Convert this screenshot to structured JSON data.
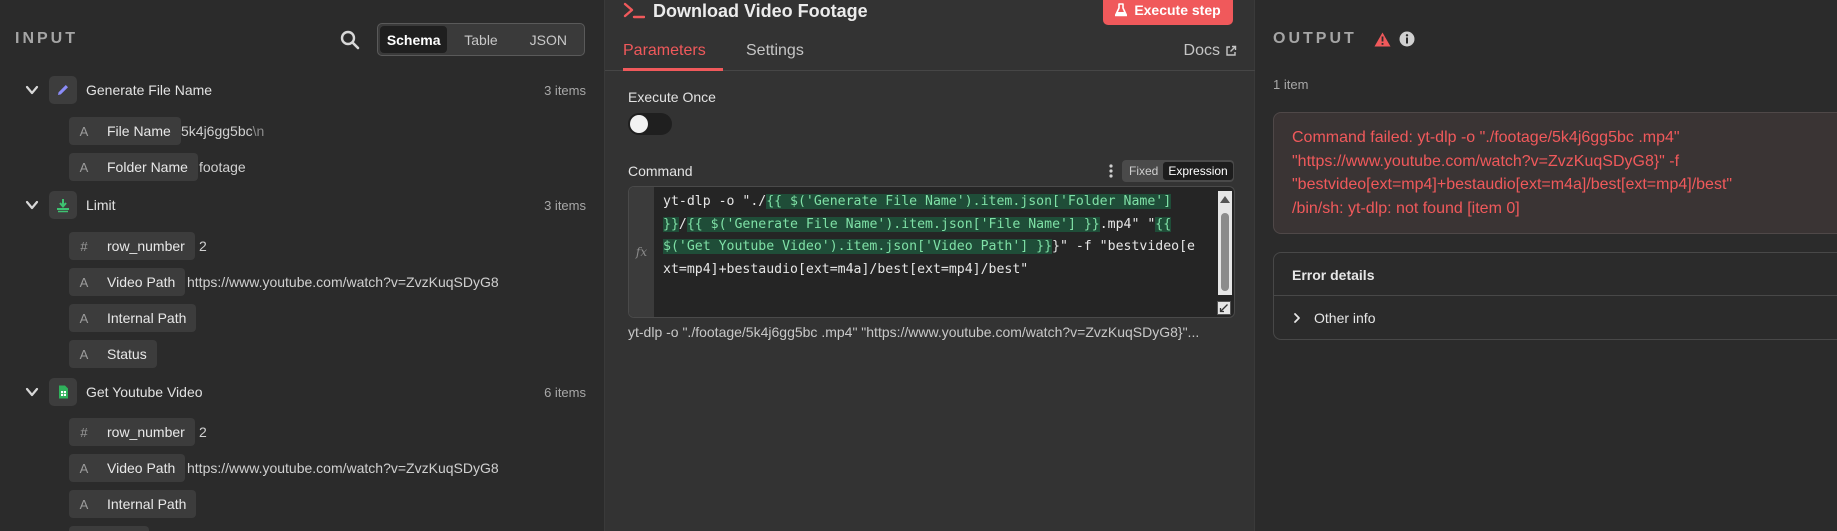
{
  "input": {
    "title": "INPUT",
    "view_options": [
      "Schema",
      "Table",
      "JSON"
    ],
    "nodes": [
      {
        "name": "Generate File Name",
        "count": "3 items",
        "icon": "pencil-icon",
        "fields": [
          {
            "type": "A",
            "name": "File Name",
            "value": "5k4j6gg5bc",
            "value_suffix": "\\n"
          },
          {
            "type": "A",
            "name": "Folder Name",
            "value": "footage"
          }
        ]
      },
      {
        "name": "Limit",
        "count": "3 items",
        "icon": "limit-icon",
        "fields": [
          {
            "type": "#",
            "name": "row_number",
            "value": "2"
          },
          {
            "type": "A",
            "name": "Video Path",
            "value": "https://www.youtube.com/watch?v=ZvzKuqSDyG8"
          },
          {
            "type": "A",
            "name": "Internal Path",
            "value": ""
          },
          {
            "type": "A",
            "name": "Status",
            "value": ""
          }
        ]
      },
      {
        "name": "Get Youtube Video",
        "count": "6 items",
        "icon": "sheets-icon",
        "fields": [
          {
            "type": "#",
            "name": "row_number",
            "value": "2"
          },
          {
            "type": "A",
            "name": "Video Path",
            "value": "https://www.youtube.com/watch?v=ZvzKuqSDyG8"
          },
          {
            "type": "A",
            "name": "Internal Path",
            "value": ""
          }
        ]
      }
    ]
  },
  "params": {
    "node_title": "Download Video Footage",
    "execute_label": "Execute step",
    "tabs": [
      "Parameters",
      "Settings"
    ],
    "docs_label": "Docs",
    "execute_once_label": "Execute Once",
    "command_label": "Command",
    "mode_fixed": "Fixed",
    "mode_expression": "Expression",
    "fx_label": "fx",
    "code": {
      "l1a": "yt-dlp -o \"./",
      "l1b": "{{ $('Generate File Name').item.json['Folder Name']",
      "l2a": "}}",
      "l2b": "/",
      "l2c": "{{ $('Generate File Name').item.json['File Name'] }}",
      "l2d": ".mp4\" \"",
      "l2e": "{{",
      "l3a": "$('Get Youtube Video').item.json['Video Path'] }}",
      "l3b": "}\" -f \"bestvideo[e",
      "l4": "xt=mp4]+bestaudio[ext=m4a]/best[ext=mp4]/best\""
    },
    "result_preview": "yt-dlp -o \"./footage/5k4j6gg5bc .mp4\" \"https://www.youtube.com/watch?v=ZvzKuqSDyG8}\"..."
  },
  "output": {
    "title": "OUTPUT",
    "item_count": "1 item",
    "error_lines": [
      "Command failed: yt-dlp -o \"./footage/5k4j6gg5bc .mp4\"",
      "\"https://www.youtube.com/watch?v=ZvzKuqSDyG8}\" -f",
      "\"bestvideo[ext=mp4]+bestaudio[ext=m4a]/best[ext=mp4]/best\"",
      "/bin/sh: yt-dlp: not found [item 0]"
    ],
    "details_title": "Error details",
    "other_info": "Other info"
  },
  "colors": {
    "accent": "#f0595b",
    "expression_highlight": "#7fe0a6",
    "panel_bg": "#2b2b2b"
  }
}
